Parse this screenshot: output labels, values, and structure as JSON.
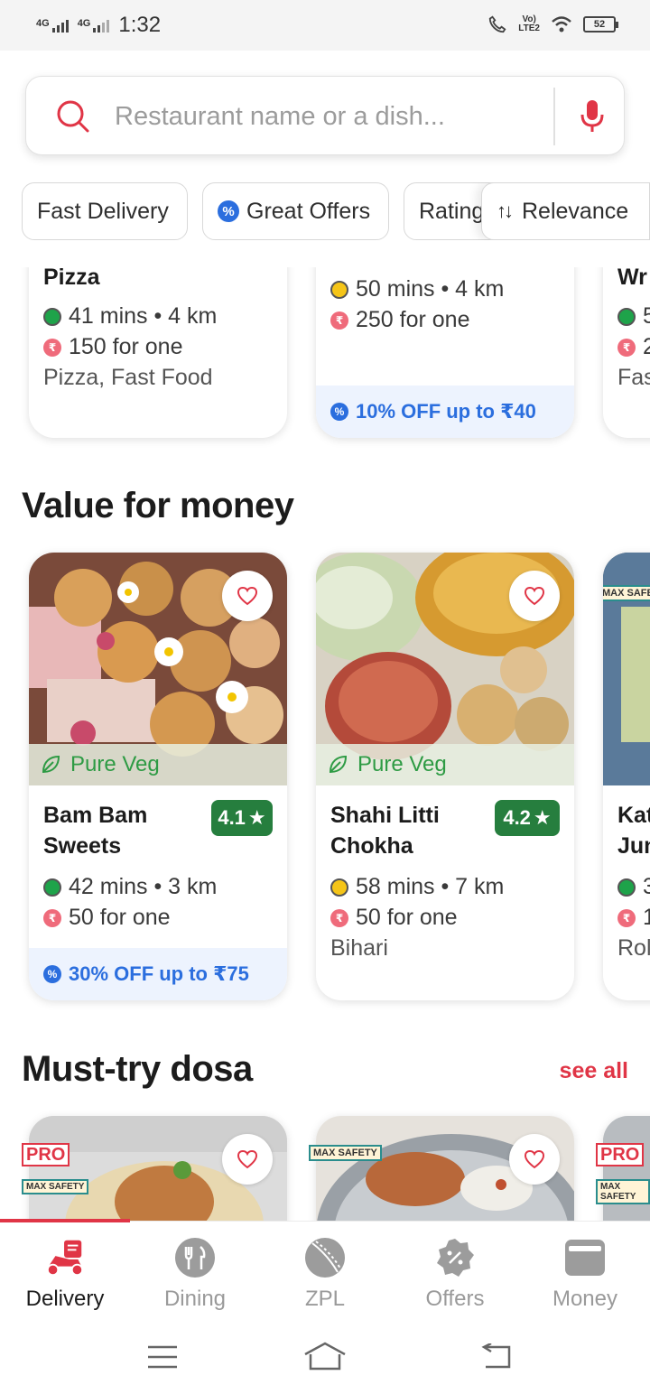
{
  "status_bar": {
    "time": "1:32",
    "network1": "4G",
    "network2": "4G",
    "battery": "52",
    "volte_line1": "Vo)",
    "volte_line2": "LTE2"
  },
  "search": {
    "placeholder": "Restaurant name or a dish..."
  },
  "filters": {
    "fast_delivery": "Fast Delivery",
    "great_offers": "Great Offers",
    "rating": "Rating",
    "relevance": "Relevance"
  },
  "top_row": {
    "card1": {
      "name": "Pizza",
      "time": "41 mins • 4 km",
      "price": "150 for one",
      "cuisine": "Pizza, Fast Food"
    },
    "card2": {
      "time": "50 mins • 4 km",
      "price": "250 for one",
      "offer": "10% OFF up to ₹40"
    },
    "card3": {
      "name": "Wr",
      "time": "5",
      "price": "2",
      "cuisine": "Fas"
    }
  },
  "value_for_money": {
    "title": "Value for money",
    "cards": [
      {
        "veg_label": "Pure Veg",
        "name_line1": "Bam Bam",
        "name_line2": "Sweets",
        "rating": "4.1",
        "time": "42 mins • 3 km",
        "price": "50 for one",
        "offer": "30% OFF up to ₹75"
      },
      {
        "veg_label": "Pure Veg",
        "name_line1": "Shahi Litti",
        "name_line2": "Chokha",
        "rating": "4.2",
        "time": "58 mins • 7 km",
        "price": "50 for one",
        "cuisine": "Bihari"
      },
      {
        "badge": "MAX SAFE",
        "name_line1": "Kat",
        "name_line2": "Jun",
        "time": "3",
        "price": "1",
        "cuisine": "Rol"
      }
    ]
  },
  "must_try_dosa": {
    "title": "Must-try dosa",
    "see_all": "see all",
    "badges": {
      "pro": "PRO",
      "safety": "MAX SAFETY"
    }
  },
  "bottom_nav": {
    "items": [
      {
        "label": "Delivery"
      },
      {
        "label": "Dining"
      },
      {
        "label": "ZPL"
      },
      {
        "label": "Offers"
      },
      {
        "label": "Money"
      }
    ]
  },
  "colors": {
    "brand_red": "#e03546",
    "rating_green": "#267e3e",
    "offer_blue": "#2b6ede",
    "veg_green": "#2e9b44"
  }
}
